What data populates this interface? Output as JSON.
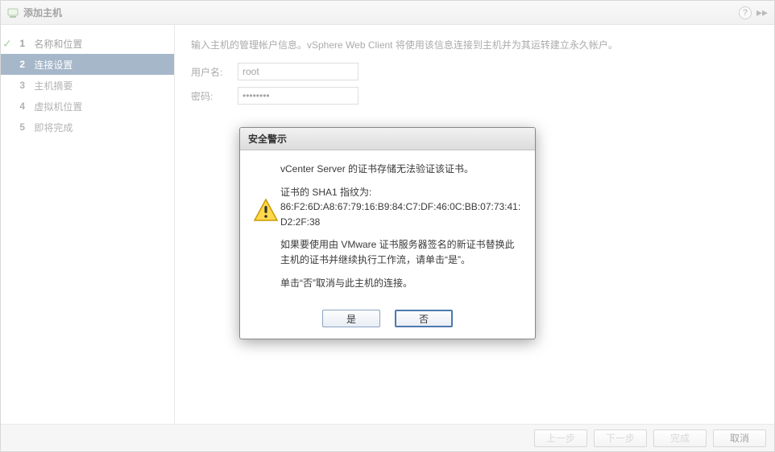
{
  "window": {
    "title": "添加主机",
    "help_tooltip": "?",
    "pin_glyph": "▸▸"
  },
  "steps": [
    {
      "num": "1",
      "label": "名称和位置",
      "state": "done"
    },
    {
      "num": "2",
      "label": "连接设置",
      "state": "active"
    },
    {
      "num": "3",
      "label": "主机摘要",
      "state": ""
    },
    {
      "num": "4",
      "label": "虚拟机位置",
      "state": ""
    },
    {
      "num": "5",
      "label": "即将完成",
      "state": ""
    }
  ],
  "form": {
    "instruction": "输入主机的管理帐户信息。vSphere Web Client 将使用该信息连接到主机并为其运转建立永久帐户。",
    "username_label": "用户名:",
    "username_value": "root",
    "password_label": "密码:",
    "password_value": "********"
  },
  "footer": {
    "back": "上一步",
    "next": "下一步",
    "finish": "完成",
    "cancel": "取消"
  },
  "dialog": {
    "title": "安全警示",
    "line1": "vCenter Server 的证书存储无法验证该证书。",
    "line2": "证书的 SHA1 指纹为:",
    "fingerprint": "86:F2:6D:A8:67:79:16:B9:84:C7:DF:46:0C:BB:07:73:41:D2:2F:38",
    "line3": "如果要使用由 VMware 证书服务器签名的新证书替换此主机的证书并继续执行工作流，请单击“是”。",
    "line4": "单击“否”取消与此主机的连接。",
    "yes": "是",
    "no": "否"
  }
}
